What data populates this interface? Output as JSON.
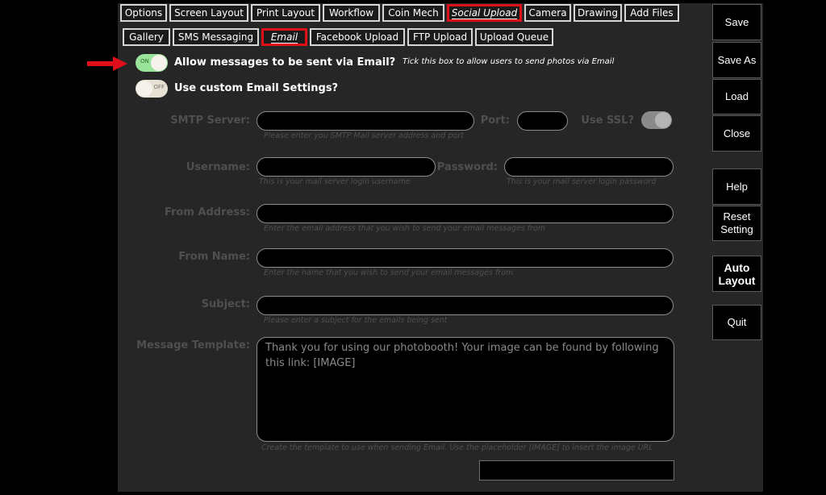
{
  "main_tabs": [
    {
      "label": "Options"
    },
    {
      "label": "Screen Layout"
    },
    {
      "label": "Print Layout"
    },
    {
      "label": "Workflow"
    },
    {
      "label": "Coin Mech"
    },
    {
      "label": "Social Upload"
    },
    {
      "label": "Camera"
    },
    {
      "label": "Drawing"
    },
    {
      "label": "Add Files"
    }
  ],
  "main_tab_selected": "Social Upload",
  "sub_tabs": [
    {
      "label": "Gallery"
    },
    {
      "label": "SMS Messaging"
    },
    {
      "label": "Email"
    },
    {
      "label": "Facebook Upload"
    },
    {
      "label": "FTP Upload"
    },
    {
      "label": "Upload Queue"
    }
  ],
  "sub_tab_selected": "Email",
  "allow_email": {
    "label": "Allow messages to be sent via Email?",
    "state": "ON",
    "note": "Tick this box to allow users to send photos via Email"
  },
  "custom_settings": {
    "label": "Use custom Email Settings?",
    "state": "OFF"
  },
  "smtp": {
    "label": "SMTP Server:",
    "value": "",
    "hint": "Please enter you SMTP Mail server address and port"
  },
  "port": {
    "label": "Port:",
    "value": ""
  },
  "ssl": {
    "label": "Use SSL?",
    "state": "on"
  },
  "username": {
    "label": "Username:",
    "value": "",
    "hint": "This is your mail server login username"
  },
  "password": {
    "label": "Password:",
    "value": "",
    "hint": "This is your mail server login password"
  },
  "from_address": {
    "label": "From Address:",
    "value": "",
    "hint": "Enter the email address that you wish to send your email messages from"
  },
  "from_name": {
    "label": "From Name:",
    "value": "",
    "hint": "Enter the name that you wish to send your email messages from"
  },
  "subject": {
    "label": "Subject:",
    "value": "",
    "hint": "Please enter a subject for the emails being sent"
  },
  "message_template": {
    "label": "Message Template:",
    "value": "Thank you for using our photobooth! Your image can be found by following this link: [IMAGE]",
    "hint": "Create the template to use when sending Email. Use the placeholder [IMAGE] to insert the image URL"
  },
  "side_buttons": {
    "save": "Save",
    "save_as": "Save As",
    "load": "Load",
    "close": "Close",
    "help": "Help",
    "reset_line1": "Reset",
    "reset_line2": "Setting",
    "auto_line1": "Auto",
    "auto_line2": "Layout",
    "quit": "Quit"
  },
  "colors": {
    "active_tab_border": "#e0101b",
    "toggle_on": "#9ae39a",
    "panel_bg": "#262626",
    "arrow": "#e0101b"
  }
}
